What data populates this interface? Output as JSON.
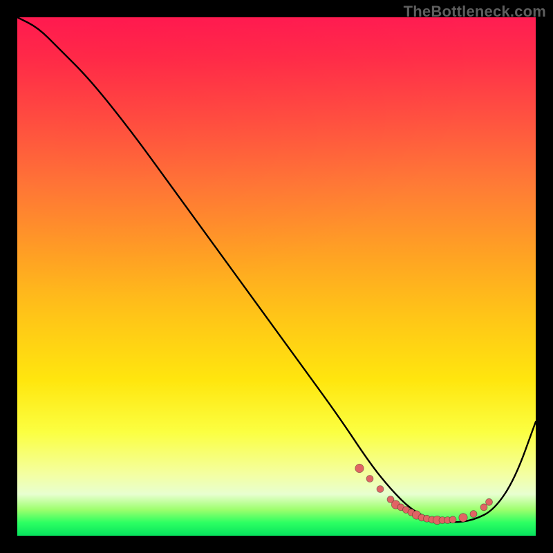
{
  "watermark": "TheBottleneck.com",
  "chart_data": {
    "type": "line",
    "title": "",
    "xlabel": "",
    "ylabel": "",
    "xlim": [
      0,
      100
    ],
    "ylim": [
      0,
      100
    ],
    "grid": false,
    "series": [
      {
        "name": "curve",
        "x": [
          0,
          4,
          8,
          14,
          22,
          30,
          38,
          46,
          54,
          62,
          68,
          72,
          76,
          80,
          84,
          88,
          92,
          96,
          100
        ],
        "y": [
          100,
          98,
          94,
          88,
          78,
          67,
          56,
          45,
          34,
          23,
          14,
          9,
          5,
          3,
          2.5,
          3,
          5,
          11,
          22
        ]
      }
    ],
    "highlight_points": {
      "name": "valley-dots",
      "x": [
        66,
        68,
        70,
        72,
        73,
        74,
        75,
        76,
        77,
        78,
        79,
        80,
        81,
        82,
        83,
        84,
        86,
        88,
        90,
        91
      ],
      "y": [
        13,
        11,
        9,
        7,
        6,
        5.5,
        5,
        4.5,
        4,
        3.5,
        3.3,
        3.1,
        3.0,
        3.0,
        3.0,
        3.1,
        3.5,
        4.2,
        5.5,
        6.5
      ]
    },
    "background": {
      "description": "vertical rainbow gradient red→orange→yellow→pale→green band at bottom",
      "stops": [
        {
          "pos": 0.0,
          "color": "#ff1d52"
        },
        {
          "pos": 0.32,
          "color": "#ff7a36"
        },
        {
          "pos": 0.7,
          "color": "#ffe60e"
        },
        {
          "pos": 0.92,
          "color": "#e8ffd0"
        },
        {
          "pos": 1.0,
          "color": "#07e35e"
        }
      ]
    }
  }
}
